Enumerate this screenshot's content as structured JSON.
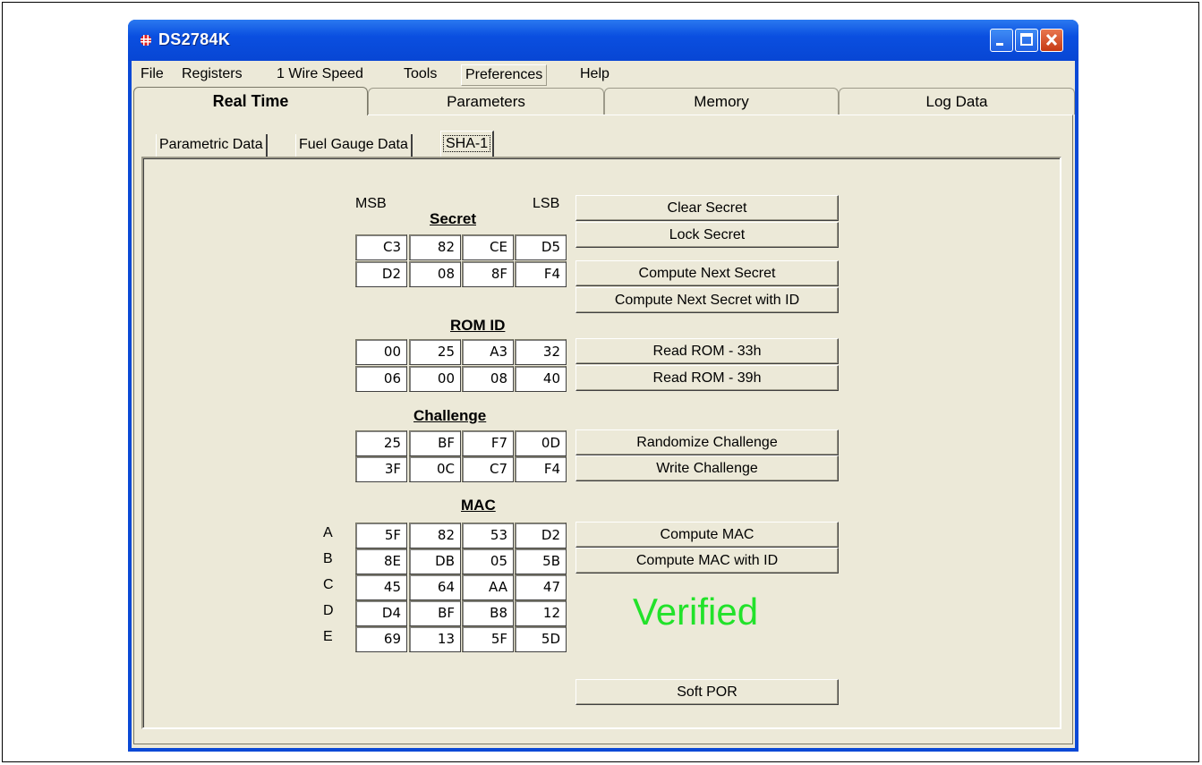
{
  "window": {
    "title": "DS2784K"
  },
  "menu": [
    "File",
    "Registers",
    "1 Wire Speed",
    "Tools",
    "Preferences",
    "Help"
  ],
  "main_tabs": [
    "Real Time",
    "Parameters",
    "Memory",
    "Log Data"
  ],
  "sub_tabs": [
    "Parametric Data",
    "Fuel Gauge Data",
    "SHA-1"
  ],
  "secret": {
    "title": "Secret",
    "msb_label": "MSB",
    "lsb_label": "LSB",
    "rows": [
      [
        "C3",
        "82",
        "CE",
        "D5"
      ],
      [
        "D2",
        "08",
        "8F",
        "F4"
      ]
    ]
  },
  "rom_id": {
    "title": "ROM ID",
    "rows": [
      [
        "00",
        "25",
        "A3",
        "32"
      ],
      [
        "06",
        "00",
        "08",
        "40"
      ]
    ]
  },
  "challenge": {
    "title": "Challenge",
    "rows": [
      [
        "25",
        "BF",
        "F7",
        "0D"
      ],
      [
        "3F",
        "0C",
        "C7",
        "F4"
      ]
    ]
  },
  "mac": {
    "title": "MAC",
    "row_labels": [
      "A",
      "B",
      "C",
      "D",
      "E"
    ],
    "rows": [
      [
        "5F",
        "82",
        "53",
        "D2"
      ],
      [
        "8E",
        "DB",
        "05",
        "5B"
      ],
      [
        "45",
        "64",
        "AA",
        "47"
      ],
      [
        "D4",
        "BF",
        "B8",
        "12"
      ],
      [
        "69",
        "13",
        "5F",
        "5D"
      ]
    ]
  },
  "buttons": {
    "clear_secret": "Clear Secret",
    "lock_secret": "Lock Secret",
    "compute_next_secret": "Compute Next Secret",
    "compute_next_secret_id": "Compute Next Secret with ID",
    "read_rom_33": "Read ROM - 33h",
    "read_rom_39": "Read ROM - 39h",
    "randomize_challenge": "Randomize Challenge",
    "write_challenge": "Write Challenge",
    "compute_mac": "Compute MAC",
    "compute_mac_id": "Compute MAC with ID",
    "soft_por": "Soft POR"
  },
  "status": {
    "verified": "Verified",
    "verified_color": "#22e22a"
  },
  "icons": {
    "app": "chip-icon",
    "minimize": "minimize-icon",
    "maximize": "maximize-icon",
    "close": "close-icon"
  }
}
